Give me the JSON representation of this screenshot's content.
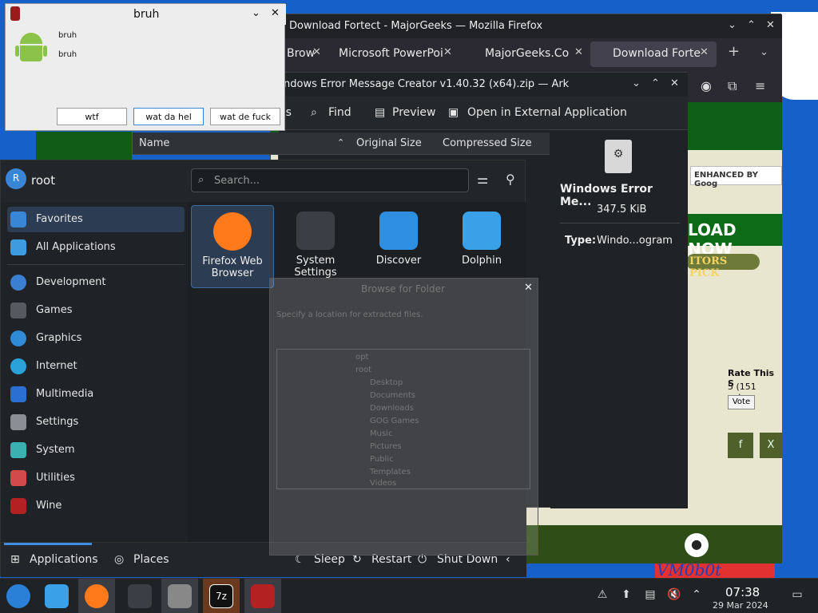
{
  "wine_dialog": {
    "title": "bruh",
    "message_line1": "bruh",
    "message_line2": "bruh",
    "buttons": [
      "wtf",
      "wat da hel",
      "wat de fuck"
    ]
  },
  "firefox": {
    "window_title": "Download Fortect - MajorGeeks — Mozilla Firefox",
    "tabs": [
      {
        "label": "Brow",
        "active": false
      },
      {
        "label": "Microsoft PowerPoi",
        "active": false
      },
      {
        "label": "MajorGeeks.Co",
        "active": false
      },
      {
        "label": "Download Forte",
        "active": true
      }
    ],
    "page": {
      "search_label": "ENHANCED BY Goog",
      "download_button": "LOAD NOW",
      "editors_pick": "ITORS PICK",
      "rate_title": "Rate This S",
      "rate_votes": "5 (151 votes",
      "vote_button": "Vote"
    }
  },
  "ark": {
    "window_title": "ndows Error Message Creator v1.40.32 (x64).zip — Ark",
    "toolbar": {
      "partial": "es",
      "find": "Find",
      "preview": "Preview",
      "open_external": "Open in External Application"
    },
    "columns": [
      "Name",
      "Original Size",
      "Compressed Size"
    ],
    "info": {
      "name": "Windows Error Me...",
      "size": "347.5 KiB",
      "type_label": "Type:",
      "type_value": "Windo...ogram"
    }
  },
  "kickoff": {
    "user": "root",
    "avatar_letter": "R",
    "search_placeholder": "Search...",
    "categories": [
      {
        "label": "Favorites",
        "color": "#3a86d6"
      },
      {
        "label": "All Applications",
        "color": "#3d9be0"
      },
      {
        "label": "Development",
        "color": "#3a7fd1"
      },
      {
        "label": "Games",
        "color": "#555a60"
      },
      {
        "label": "Graphics",
        "color": "#2f8ad8"
      },
      {
        "label": "Internet",
        "color": "#2aa2d8"
      },
      {
        "label": "Multimedia",
        "color": "#2a6fd1"
      },
      {
        "label": "Settings",
        "color": "#8a8f95"
      },
      {
        "label": "System",
        "color": "#3ab0b0"
      },
      {
        "label": "Utilities",
        "color": "#d34a4a"
      },
      {
        "label": "Wine",
        "color": "#b22222"
      }
    ],
    "favorites": [
      {
        "label": "Firefox Web Browser",
        "color": "#ff7a1a"
      },
      {
        "label": "System Settings",
        "color": "#3a3f45"
      },
      {
        "label": "Discover",
        "color": "#2e8fe0"
      },
      {
        "label": "Dolphin",
        "color": "#3aa0e8"
      }
    ],
    "footer": {
      "applications": "Applications",
      "places": "Places",
      "sleep": "Sleep",
      "restart": "Restart",
      "shutdown": "Shut Down"
    }
  },
  "browse_dialog": {
    "title": "Browse for Folder",
    "prompt": "Specify a location for extracted files.",
    "folders": [
      "opt",
      "root",
      "Desktop",
      "Documents",
      "Downloads",
      "GOG Games",
      "Music",
      "Pictures",
      "Public",
      "Templates",
      "Videos"
    ]
  },
  "taskbar": {
    "time": "07:38",
    "date": "29 Mar 2024",
    "apps": [
      {
        "name": "start-button",
        "color": "#2a7fd6"
      },
      {
        "name": "file-manager",
        "color": "#3aa0e8"
      },
      {
        "name": "firefox",
        "color": "#ff7a1a"
      },
      {
        "name": "system-settings",
        "color": "#3a3f45"
      },
      {
        "name": "ark",
        "color": "#888"
      },
      {
        "name": "7zip",
        "color": "#111"
      },
      {
        "name": "wine",
        "color": "#b22222"
      }
    ]
  },
  "desktop": {
    "watermark": "VM0b0t"
  }
}
